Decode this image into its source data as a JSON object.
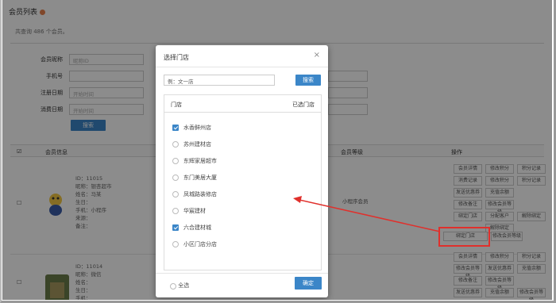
{
  "page": {
    "title": "会员列表",
    "summary": "共查询 486 个会员。"
  },
  "filters": {
    "member_label": "会员昵称",
    "member_placeholder": "昵称ID",
    "phone_label": "手机号",
    "store_label": "所属门店",
    "reg_label": "注册日期",
    "start_placeholder": "开始时间",
    "consume_label": "消费日期",
    "start2_placeholder": "开始时间",
    "search_label": "搜索"
  },
  "table": {
    "headers": [
      "会员信息",
      "会员等级",
      "操作"
    ],
    "row1": {
      "lines": [
        "ID：11015",
        "昵称：银杏超市",
        "姓名：马某",
        "生日：",
        "手机：小程序",
        "来源：",
        "备注："
      ],
      "level": "小程序会员",
      "ops": [
        "会员详情",
        "修改积分",
        "积分记录",
        "消费记录",
        "发送优惠券",
        "充值余额",
        "修改备注",
        "修改会员等级",
        "绑定门店",
        "分配客户",
        "解除绑定",
        "修改会员等级"
      ]
    },
    "row2": {
      "lines": [
        "ID：11014",
        "昵称：微信",
        "姓名：",
        "生日：",
        "手机："
      ],
      "ops": [
        "会员详情",
        "修改积分",
        "积分记录",
        "修改会员等级",
        "发送优惠券",
        "充值余额",
        "修改备注",
        "修改会员等级"
      ]
    }
  },
  "modal": {
    "title": "选择门店",
    "close": "×",
    "search_value": "例：文一店",
    "search_button": "搜索",
    "list_header_left": "门店",
    "list_header_right": "已选门店",
    "stores": [
      {
        "name": "水香鲜州店",
        "checked": true
      },
      {
        "name": "苏州建材店",
        "checked": false
      },
      {
        "name": "东辉家居超市",
        "checked": false
      },
      {
        "name": "东门美居大厦",
        "checked": false
      },
      {
        "name": "凤城路装修店",
        "checked": false
      },
      {
        "name": "华宸建材",
        "checked": false
      },
      {
        "name": "六合建材城",
        "checked": true
      },
      {
        "name": "小区门店分店",
        "checked": false
      }
    ],
    "select_all": "全选",
    "confirm": "确定"
  },
  "colors": {
    "accent": "#3b86c8",
    "annotation": "#e0302c"
  }
}
